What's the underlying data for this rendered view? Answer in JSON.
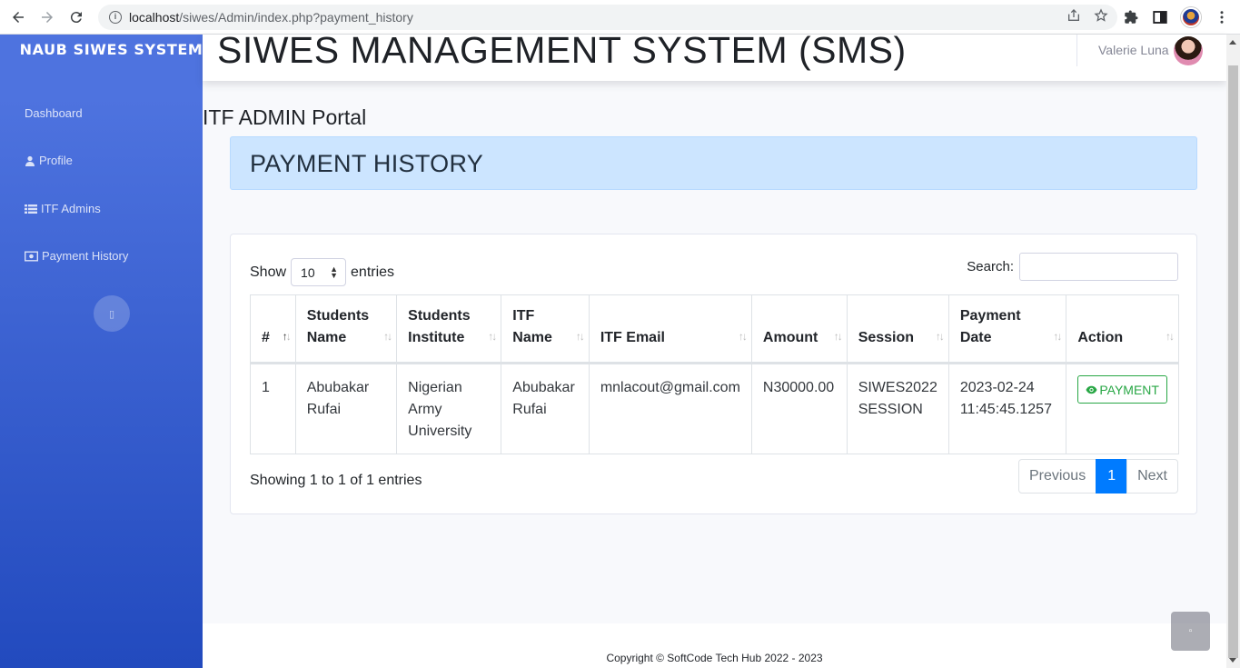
{
  "browser": {
    "url_host": "localhost",
    "url_path": "/siwes/Admin/index.php?payment_history"
  },
  "sidebar": {
    "brand": "NAUB SIWES SYSTEM",
    "items": [
      {
        "label": "Dashboard",
        "icon": "dashboard-icon"
      },
      {
        "label": "Profile",
        "icon": "user-icon"
      },
      {
        "label": "ITF Admins",
        "icon": "list-icon"
      },
      {
        "label": "Payment History",
        "icon": "money-icon"
      }
    ],
    "toggle_glyph": "▯"
  },
  "topbar": {
    "title": "SIWES MANAGEMENT SYSTEM (SMS)",
    "user_name": "Valerie Luna"
  },
  "page": {
    "portal_title": "ITF ADMIN Portal",
    "heading": "PAYMENT HISTORY"
  },
  "table_controls": {
    "show_label": "Show",
    "entries_value": "10",
    "entries_label": "entries",
    "search_label": "Search:",
    "search_value": ""
  },
  "table": {
    "columns": [
      "#",
      "Students Name",
      "Students Institute",
      "ITF Name",
      "ITF Email",
      "Amount",
      "Session",
      "Payment Date",
      "Action"
    ],
    "rows": [
      {
        "num": "1",
        "student_name": "Abubakar Rufai",
        "institute": "Nigerian Army University",
        "itf_name": "Abubakar Rufai",
        "itf_email": "mnlacout@gmail.com",
        "amount": "N30000.00",
        "session": "SIWES2022 SESSION",
        "payment_date": "2023-02-24 11:45:45.1257",
        "action_label": "PAYMENT"
      }
    ]
  },
  "pagination": {
    "info": "Showing 1 to 1 of 1 entries",
    "previous": "Previous",
    "current": "1",
    "next": "Next"
  },
  "footer": {
    "copyright": "Copyright © SoftCode Tech Hub 2022 - 2023"
  },
  "scroll_top_glyph": "▫",
  "colors": {
    "sidebar_top": "#4e73df",
    "sidebar_bottom": "#224abe",
    "alert_bg": "#cce5ff",
    "active_page": "#007bff",
    "action_green": "#28a745"
  }
}
